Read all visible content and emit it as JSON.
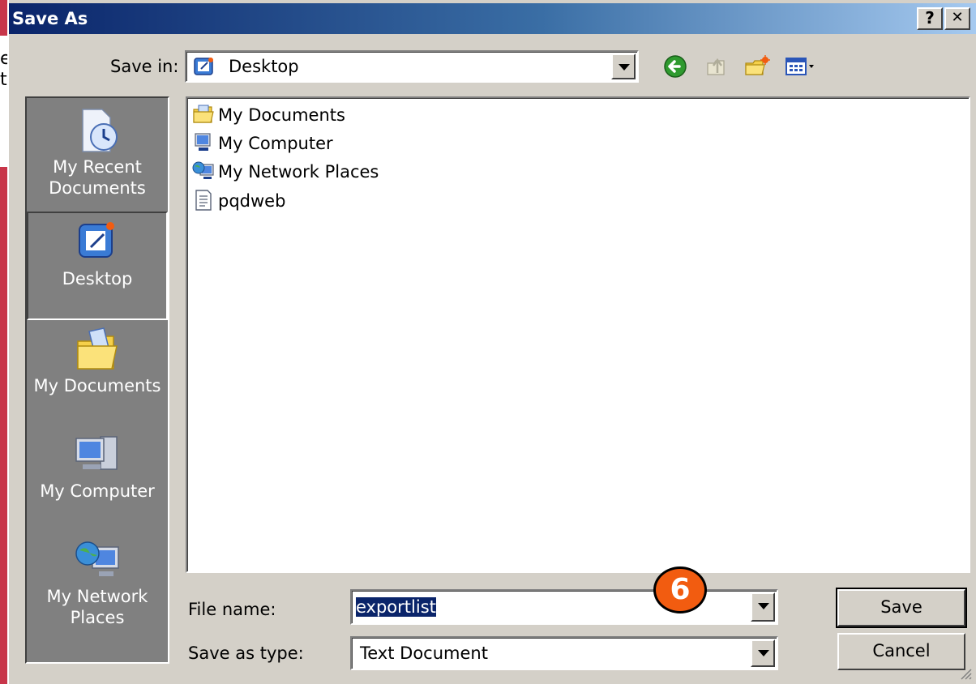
{
  "dialog": {
    "title": "Save As",
    "help_button": "?",
    "close_button": "✕"
  },
  "toolbar": {
    "save_in_label": "Save in:",
    "save_in_value": "Desktop",
    "icons": [
      "back-icon",
      "up-folder-icon",
      "new-folder-icon",
      "views-menu-icon"
    ]
  },
  "places": [
    {
      "label_line1": "My Recent",
      "label_line2": "Documents",
      "icon": "recent-documents-icon"
    },
    {
      "label_line1": "Desktop",
      "label_line2": "",
      "icon": "desktop-icon",
      "selected": true
    },
    {
      "label_line1": "My Documents",
      "label_line2": "",
      "icon": "my-documents-icon"
    },
    {
      "label_line1": "My Computer",
      "label_line2": "",
      "icon": "my-computer-icon"
    },
    {
      "label_line1": "My Network",
      "label_line2": "Places",
      "icon": "network-places-icon"
    }
  ],
  "files": [
    {
      "label": "My Documents",
      "icon": "folder-icon"
    },
    {
      "label": "My Computer",
      "icon": "computer-icon"
    },
    {
      "label": "My Network Places",
      "icon": "network-icon"
    },
    {
      "label": "pqdweb",
      "icon": "text-file-icon"
    }
  ],
  "form": {
    "file_name_label": "File name:",
    "file_name_value": "exportlist",
    "save_type_label": "Save as type:",
    "save_type_value": "Text Document"
  },
  "buttons": {
    "save": "Save",
    "cancel": "Cancel"
  },
  "annotation": {
    "step_number": "6"
  },
  "colors": {
    "title_bar_start": "#0a246a",
    "title_bar_end": "#a6caf0",
    "dialog_face": "#d4d0c8",
    "places_bar": "#808080",
    "selection": "#0a246a",
    "callout": "#f25c10",
    "background_app": "#c8364a"
  }
}
